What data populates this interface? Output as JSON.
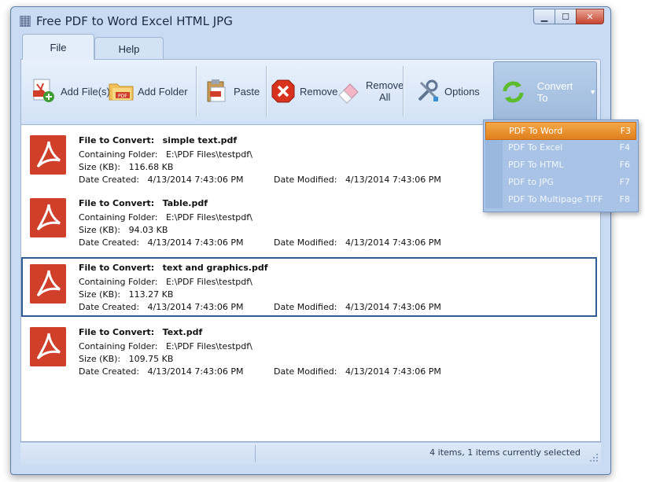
{
  "window": {
    "title": "Free PDF to Word Excel HTML JPG",
    "controls": {
      "minimize": "▁",
      "maximize": "☐",
      "close": "✕"
    }
  },
  "tabs": [
    {
      "label": "File",
      "active": true
    },
    {
      "label": "Help",
      "active": false
    }
  ],
  "toolbar": {
    "add_files": "Add File(s)",
    "add_folder": "Add Folder",
    "paste": "Paste",
    "remove": "Remove",
    "remove_all_line1": "Remove",
    "remove_all_line2": "All",
    "options": "Options",
    "convert_to": "Convert To"
  },
  "labels": {
    "file_to_convert": "File to Convert:",
    "containing_folder": "Containing Folder:",
    "size": "Size (KB):",
    "date_created": "Date Created:",
    "date_modified": "Date Modified:"
  },
  "files": [
    {
      "name": "simple text.pdf",
      "folder": "E:\\PDF Files\\testpdf\\",
      "size": "116.68 KB",
      "created": "4/13/2014 7:43:06 PM",
      "modified": "4/13/2014 7:43:06 PM",
      "selected": false
    },
    {
      "name": "Table.pdf",
      "folder": "E:\\PDF Files\\testpdf\\",
      "size": "94.03 KB",
      "created": "4/13/2014 7:43:06 PM",
      "modified": "4/13/2014 7:43:06 PM",
      "selected": false
    },
    {
      "name": "text and graphics.pdf",
      "folder": "E:\\PDF Files\\testpdf\\",
      "size": "113.27 KB",
      "created": "4/13/2014 7:43:06 PM",
      "modified": "4/13/2014 7:43:06 PM",
      "selected": true
    },
    {
      "name": "Text.pdf",
      "folder": "E:\\PDF Files\\testpdf\\",
      "size": "109.75 KB",
      "created": "4/13/2014 7:43:06 PM",
      "modified": "4/13/2014 7:43:06 PM",
      "selected": false
    }
  ],
  "convert_menu": [
    {
      "label": "PDF To Word",
      "shortcut": "F3",
      "highlighted": true
    },
    {
      "label": "PDF To Excel",
      "shortcut": "F4",
      "highlighted": false
    },
    {
      "label": "PDF To HTML",
      "shortcut": "F6",
      "highlighted": false
    },
    {
      "label": "PDF to JPG",
      "shortcut": "F7",
      "highlighted": false
    },
    {
      "label": "PDF To Multipage TIFF",
      "shortcut": "F8",
      "highlighted": false
    }
  ],
  "status": {
    "text": "4 items, 1 items currently selected"
  },
  "colors": {
    "window_bg": "#c9dbf3",
    "pdf_red": "#d03f2a",
    "selection_border": "#2f5d94",
    "menu_highlight": "#e8891f",
    "menu_bg": "#a8c3e6"
  }
}
